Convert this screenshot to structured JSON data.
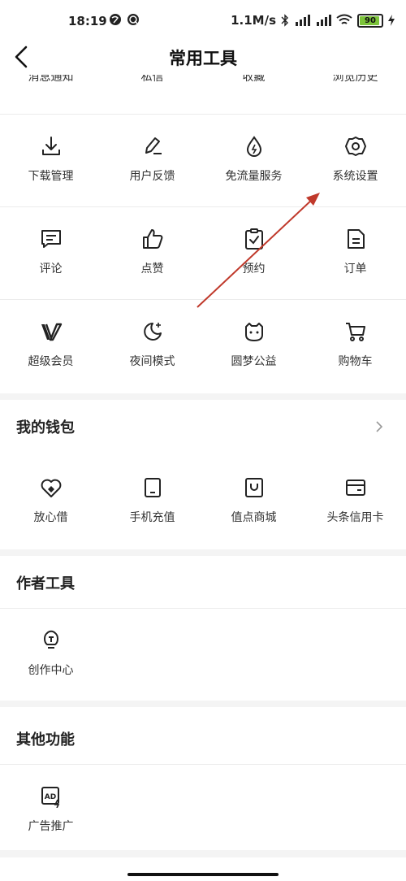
{
  "status_bar": {
    "time": "18:19",
    "network_speed": "1.1M/s",
    "battery": "90"
  },
  "header": {
    "title": "常用工具"
  },
  "top_row_cut": [
    "消息通知",
    "私信",
    "收藏",
    "浏览历史"
  ],
  "tools": [
    {
      "label": "下载管理",
      "icon": "download-icon"
    },
    {
      "label": "用户反馈",
      "icon": "edit-pen-icon"
    },
    {
      "label": "免流量服务",
      "icon": "water-drop-icon"
    },
    {
      "label": "系统设置",
      "icon": "gear-icon"
    },
    {
      "label": "评论",
      "icon": "comment-icon"
    },
    {
      "label": "点赞",
      "icon": "thumbs-up-icon"
    },
    {
      "label": "预约",
      "icon": "clipboard-check-icon"
    },
    {
      "label": "订单",
      "icon": "document-icon"
    },
    {
      "label": "超级会员",
      "icon": "vip-v-icon"
    },
    {
      "label": "夜间模式",
      "icon": "moon-icon"
    },
    {
      "label": "圆梦公益",
      "icon": "charity-face-icon"
    },
    {
      "label": "购物车",
      "icon": "cart-icon"
    }
  ],
  "wallet": {
    "title": "我的钱包",
    "items": [
      {
        "label": "放心借",
        "icon": "heart-coin-icon"
      },
      {
        "label": "手机充值",
        "icon": "phone-icon"
      },
      {
        "label": "值点商城",
        "icon": "shopping-bag-icon"
      },
      {
        "label": "头条信用卡",
        "icon": "credit-card-icon"
      }
    ]
  },
  "author_tools": {
    "title": "作者工具",
    "items": [
      {
        "label": "创作中心",
        "icon": "lightbulb-icon"
      }
    ]
  },
  "other": {
    "title": "其他功能",
    "items": [
      {
        "label": "广告推广",
        "icon": "ad-icon"
      }
    ]
  },
  "colors": {
    "annotation_arrow": "#c0392b",
    "battery_fill": "#7cc43a",
    "background": "#f4f4f4"
  }
}
